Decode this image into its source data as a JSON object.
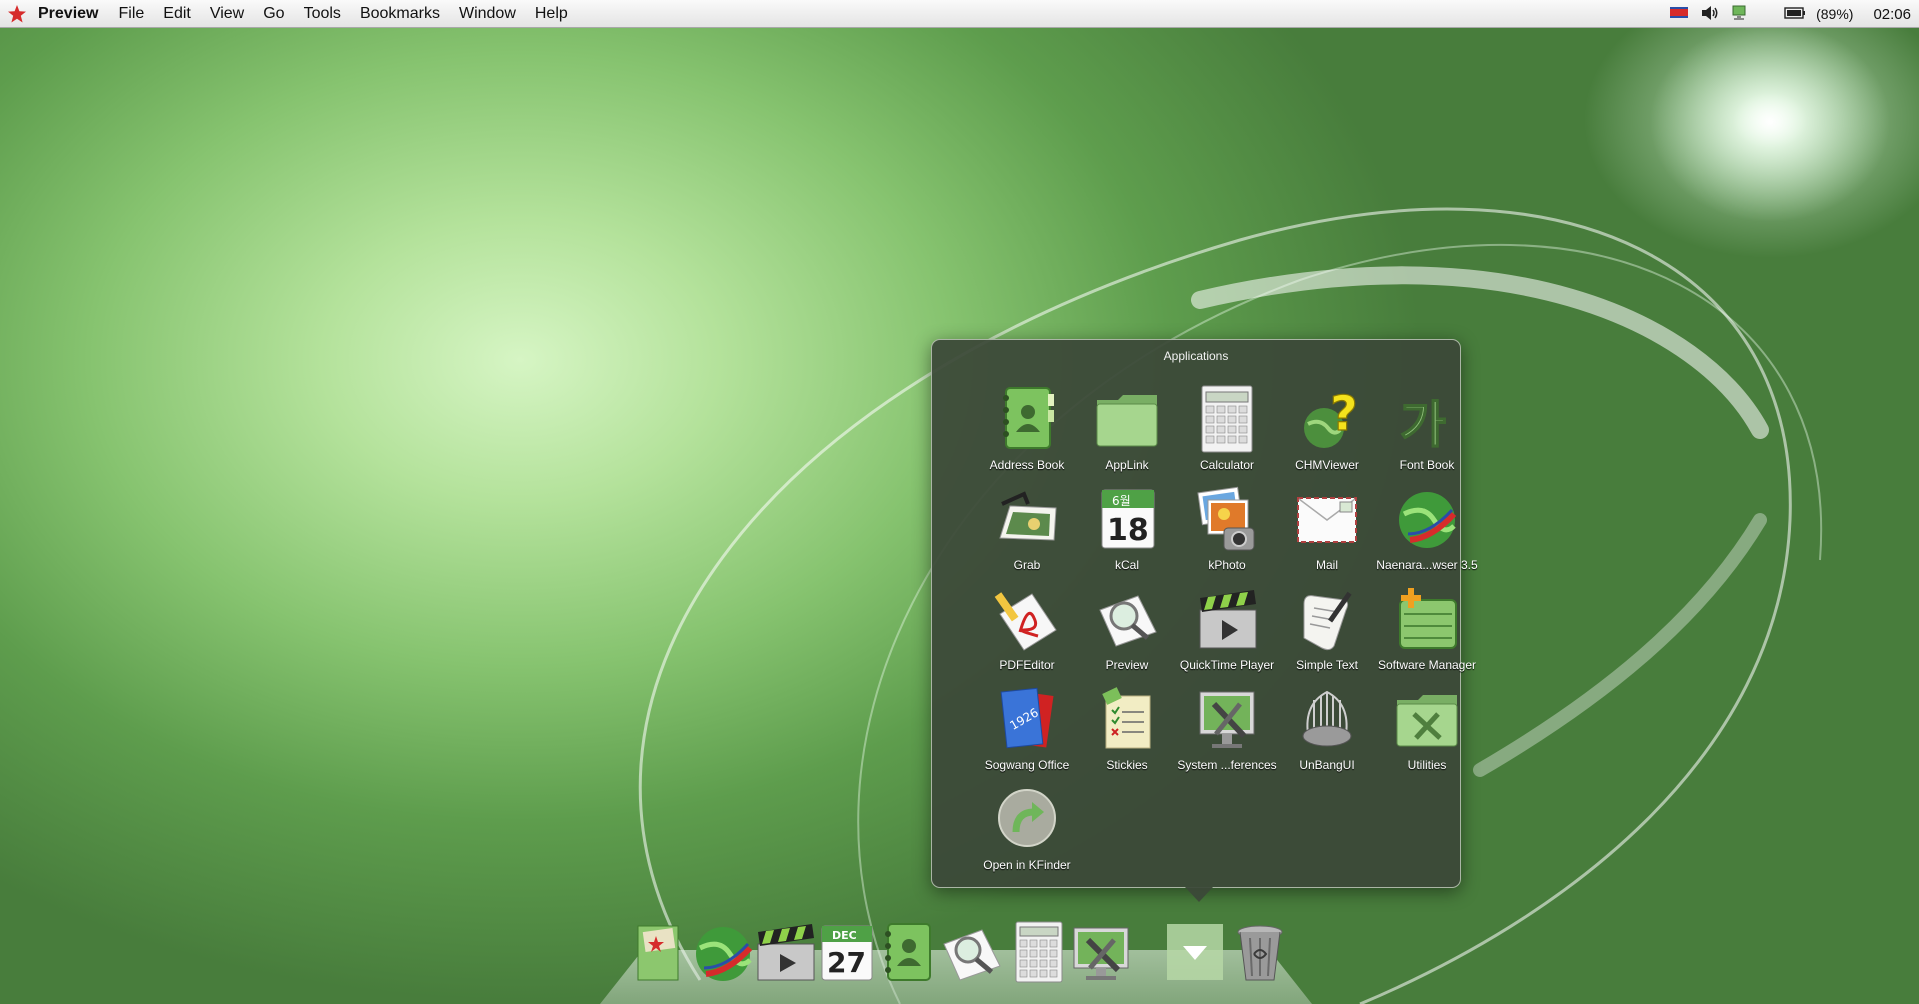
{
  "menubar": {
    "app_name": "Preview",
    "menus": [
      "File",
      "Edit",
      "View",
      "Go",
      "Tools",
      "Bookmarks",
      "Window",
      "Help"
    ],
    "battery_text": "(89%)",
    "clock": "02:06"
  },
  "stack": {
    "title": "Applications",
    "apps": [
      {
        "label": "Address Book",
        "icon": "address-book-icon"
      },
      {
        "label": "AppLink",
        "icon": "folder-icon"
      },
      {
        "label": "Calculator",
        "icon": "calculator-icon"
      },
      {
        "label": "CHMViewer",
        "icon": "chm-viewer-icon"
      },
      {
        "label": "Font Book",
        "icon": "font-book-icon"
      },
      {
        "label": "Grab",
        "icon": "grab-icon"
      },
      {
        "label": "kCal",
        "icon": "calendar-icon"
      },
      {
        "label": "kPhoto",
        "icon": "photo-icon"
      },
      {
        "label": "Mail",
        "icon": "mail-icon"
      },
      {
        "label": "Naenara...wser 3.5",
        "icon": "globe-icon"
      },
      {
        "label": "PDFEditor",
        "icon": "pdf-icon"
      },
      {
        "label": "Preview",
        "icon": "preview-icon"
      },
      {
        "label": "QuickTime Player",
        "icon": "clapperboard-icon"
      },
      {
        "label": "Simple Text",
        "icon": "text-scroll-icon"
      },
      {
        "label": "Software Manager",
        "icon": "package-icon"
      },
      {
        "label": "Sogwang Office",
        "icon": "office-icon"
      },
      {
        "label": "Stickies",
        "icon": "stickies-icon"
      },
      {
        "label": "System ...ferences",
        "icon": "system-preferences-icon"
      },
      {
        "label": "UnBangUI",
        "icon": "unbangui-icon"
      },
      {
        "label": "Utilities",
        "icon": "utilities-folder-icon"
      },
      {
        "label": "Open in KFinder",
        "icon": "open-arrow-icon"
      }
    ]
  },
  "kcal_icon": {
    "month": "6월",
    "day": "18"
  },
  "dock_calendar": {
    "month": "DEC",
    "day": "27"
  },
  "font_book_glyph": "가",
  "office_icon_text": "1926",
  "dock": [
    "photo-book-icon",
    "globe-icon",
    "clapperboard-icon",
    "calendar-icon",
    "address-book-icon",
    "preview-icon",
    "calculator-icon",
    "system-preferences-icon",
    "applications-stack-icon",
    "trash-icon"
  ],
  "colors": {
    "accent_green": "#6fb65a",
    "popup_bg": "#3c4838",
    "menubar_bg": "#ececec",
    "flag_red": "#d62b2b"
  }
}
